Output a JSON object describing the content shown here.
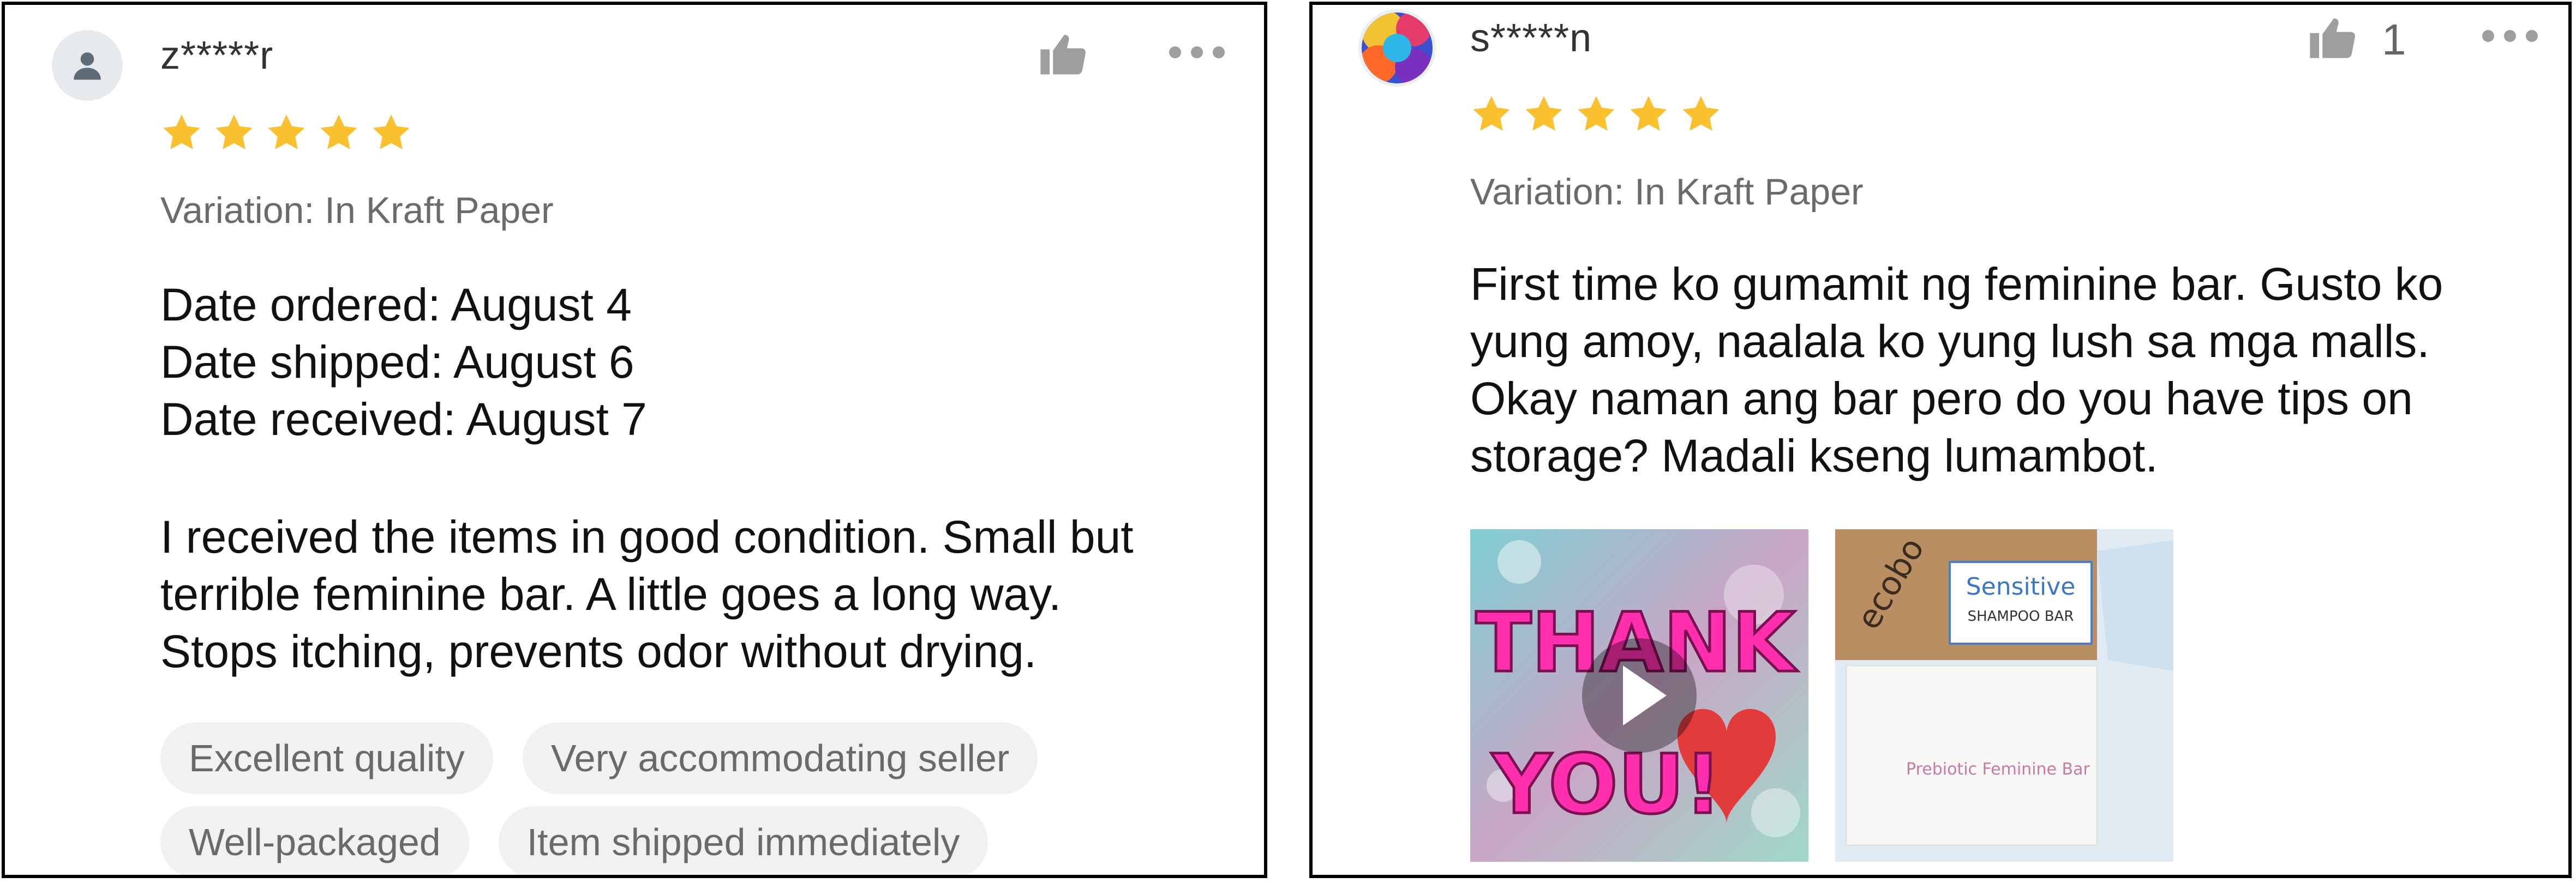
{
  "colors": {
    "star": "#FBC02D",
    "icon_gray": "#9e9e9e",
    "tag_bg": "#f1f1f1"
  },
  "reviews": [
    {
      "username": "z*****r",
      "avatar_icon": "user-silhouette-icon",
      "rating": 5,
      "variation": "Variation: In Kraft Paper",
      "date_ordered": "Date ordered: August 4",
      "date_shipped": "Date shipped: August 6",
      "date_received": "Date received: August 7",
      "text": "I received the items in good condition. Small but\nterrible feminine bar. A little goes a long way.\nStops itching, prevents odor without drying.",
      "tags": [
        "Excellent quality",
        "Very accommodating seller",
        "Well-packaged",
        "Item shipped immediately"
      ]
    },
    {
      "username": "s*****n",
      "avatar_icon": "colorful-photo-avatar",
      "rating": 5,
      "like_count": "1",
      "variation": "Variation: In Kraft Paper",
      "text": "First time ko gumamit ng feminine bar. Gusto ko\nyung amoy, naalala ko yung lush sa mga malls.\nOkay naman ang bar pero do you have tips on\nstorage? Madali kseng lumambot.",
      "media": {
        "video_overlay_text_1": "THANK",
        "video_overlay_text_2": "YOU!",
        "product_brand": "ecobo",
        "product_label_1": "Sensitive",
        "product_label_2": "SHAMPOO BAR",
        "product_label_3": "Prebiotic Feminine Bar"
      }
    }
  ]
}
